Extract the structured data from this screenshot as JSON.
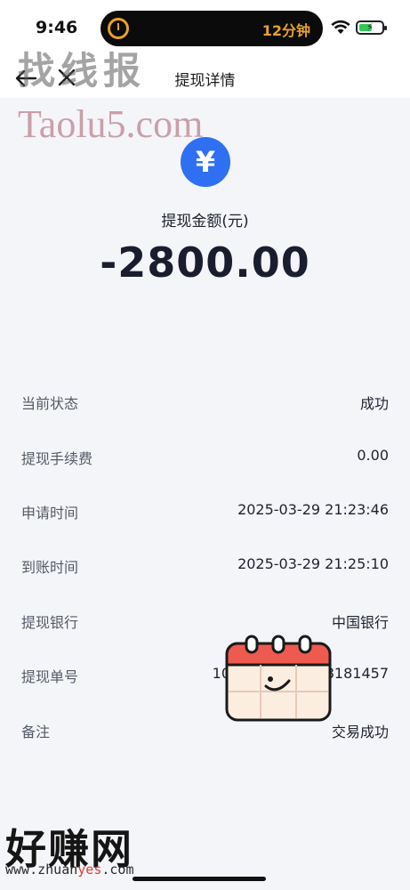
{
  "status_bar": {
    "time": "9:46",
    "island_text": "12分钟",
    "icons": [
      "timer-icon",
      "wifi-icon",
      "battery-charging-icon"
    ]
  },
  "nav": {
    "title": "提现详情",
    "back_icon": "back-arrow-icon",
    "close_icon": "close-icon"
  },
  "watermark": {
    "top_text": "找线报",
    "url": "Taolu5.com",
    "bottom_text": "好赚网",
    "bottom_url_prefix": "www.zhuan",
    "bottom_url_accent": "yes",
    "bottom_url_suffix": ".com"
  },
  "amount": {
    "currency_icon_glyph": "¥",
    "label": "提现金额(元)",
    "value": "-2800.00",
    "accent_color": "#2f6ff2"
  },
  "details": [
    {
      "label": "当前状态",
      "value": "成功"
    },
    {
      "label": "提现手续费",
      "value": "0.00"
    },
    {
      "label": "申请时间",
      "value": "2025-03-29 21:23:46"
    },
    {
      "label": "到账时间",
      "value": "2025-03-29 21:25:10"
    },
    {
      "label": "提现银行",
      "value": "中国银行"
    },
    {
      "label": "提现单号",
      "value_start": "10",
      "value_end": "8181457"
    },
    {
      "label": "备注",
      "value": "交易成功"
    }
  ]
}
